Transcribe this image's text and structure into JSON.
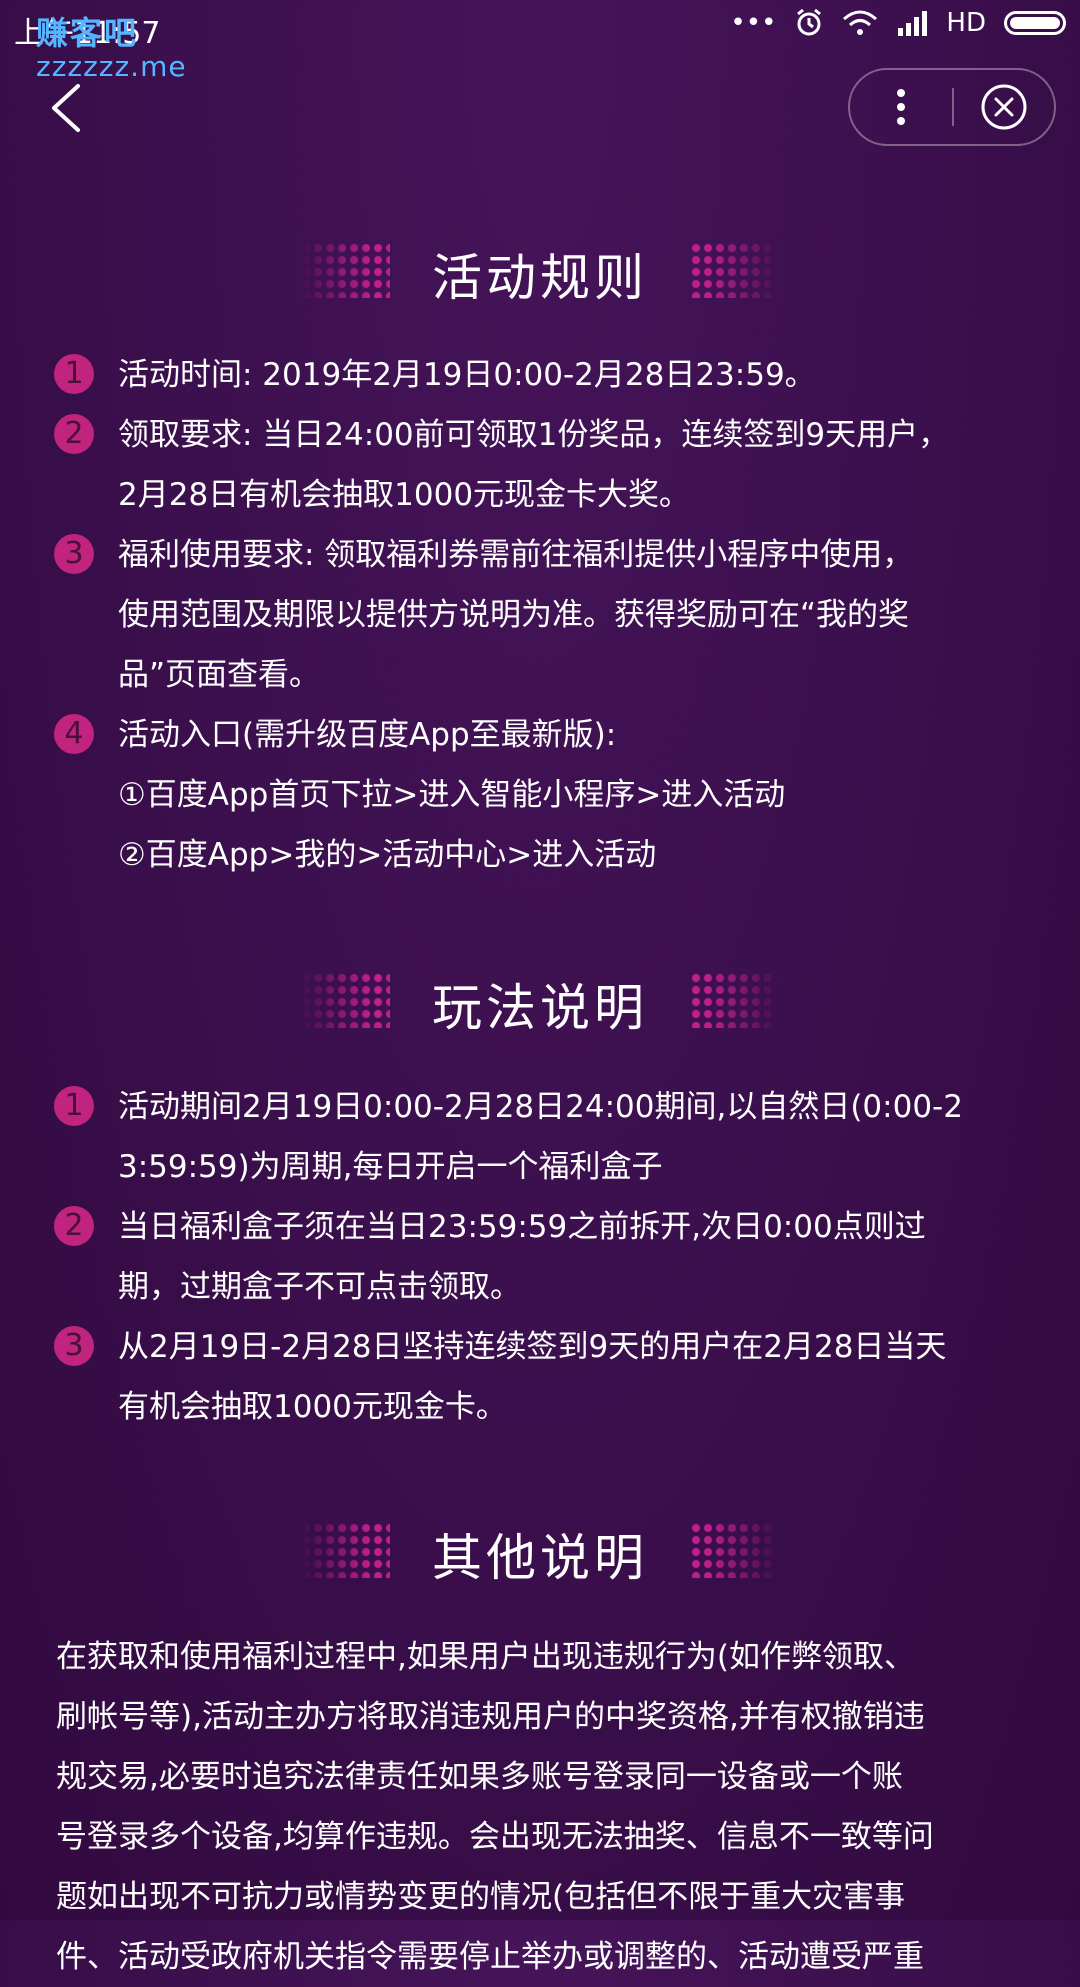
{
  "status_bar": {
    "time": "上午11:57",
    "watermark_title": "赚客吧",
    "watermark_url": "zzzzzz.me",
    "network": "HD"
  },
  "sections": {
    "rules": {
      "title": "活动规则",
      "items": [
        {
          "num": "1",
          "lines": [
            "活动时间: 2019年2月19日0:00-2月28日23:59。"
          ]
        },
        {
          "num": "2",
          "lines": [
            "领取要求: 当日24:00前可领取1份奖品，连续签到9天用户，",
            "2月28日有机会抽取1000元现金卡大奖。"
          ]
        },
        {
          "num": "3",
          "lines": [
            "福利使用要求: 领取福利券需前往福利提供小程序中使用，",
            "使用范围及期限以提供方说明为准。获得奖励可在“我的奖",
            "品”页面查看。"
          ]
        },
        {
          "num": "4",
          "lines": [
            "活动入口(需升级百度App至最新版):",
            "①百度App首页下拉>进入智能小程序>进入活动",
            "②百度App>我的>活动中心>进入活动"
          ]
        }
      ]
    },
    "gameplay": {
      "title": "玩法说明",
      "items": [
        {
          "num": "1",
          "lines": [
            "活动期间2月19日0:00-2月28日24:00期间,以自然日(0:00-2",
            "3:59:59)为周期,每日开启一个福利盒子"
          ]
        },
        {
          "num": "2",
          "lines": [
            "当日福利盒子须在当日23:59:59之前拆开,次日0:00点则过",
            "期，过期盒子不可点击领取。"
          ]
        },
        {
          "num": "3",
          "lines": [
            "从2月19日-2月28日坚持连续签到9天的用户在2月28日当天",
            "有机会抽取1000元现金卡。"
          ]
        }
      ]
    },
    "other": {
      "title": "其他说明",
      "lines": [
        "在获取和使用福利过程中,如果用户出现违规行为(如作弊领取、",
        "刷帐号等),活动主办方将取消违规用户的中奖资格,并有权撤销违",
        "规交易,必要时追究法律责任如果多账号登录同一设备或一个账",
        "号登录多个设备,均算作违规。会出现无法抽奖、信息不一致等问",
        "题如出现不可抗力或情势变更的情况(包括但不限于重大灾害事",
        "件、活动受政府机关指令需要停止举办或调整的、活动遭受严重"
      ]
    }
  }
}
